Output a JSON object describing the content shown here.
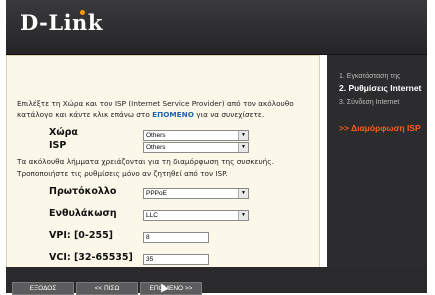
{
  "header": {
    "logo": "D-Link"
  },
  "intro": {
    "line1_a": "Επιλέξτε τη Χώρα και τον ISP (Internet Service Provider) από τον ακόλουθο",
    "line2_a": "κατάλογο και κάντε κλικ επάνω στο ",
    "line2_link": "ΕΠΟΜΕΝΟ",
    "line2_b": " για να συνεχίσετε."
  },
  "form": {
    "country_label": "Χώρα",
    "country_value": "Others",
    "isp_label": "ISP",
    "isp_value": "Others",
    "info_line1": "Τα ακόλουθα λήμματα χρειάζονται για τη διαμόρφωση της συσκευής.",
    "info_line2": "Τροποποιήστε τις ρυθμίσεις μόνο αν ζητηθεί από τον ISP.",
    "protocol_label": "Πρωτόκολλο",
    "protocol_value": "PPPoE",
    "encap_label": "Ενθυλάκωση",
    "encap_value": "LLC",
    "vpi_label": "VPI: [0-255]",
    "vpi_value": "8",
    "vci_label": "VCI: [32-65535]",
    "vci_value": "35"
  },
  "sidebar": {
    "items": [
      {
        "label": "1. Εγκατάσταση της"
      },
      {
        "label": "2. Ρυθμίσεις Internet"
      },
      {
        "label": "3. Σύνδεση Internet"
      },
      {
        "label": ">> Διαμόρφωση ISP"
      }
    ]
  },
  "footer": {
    "exit_label": "ΕΞΟΔΟΣ",
    "back_label": "<< ΠΙΣΩ",
    "next_label": "ΕΠΟΜΕΝΟ >>"
  },
  "colors": {
    "accent": "#ff5a1e",
    "link": "#1f64b3"
  }
}
